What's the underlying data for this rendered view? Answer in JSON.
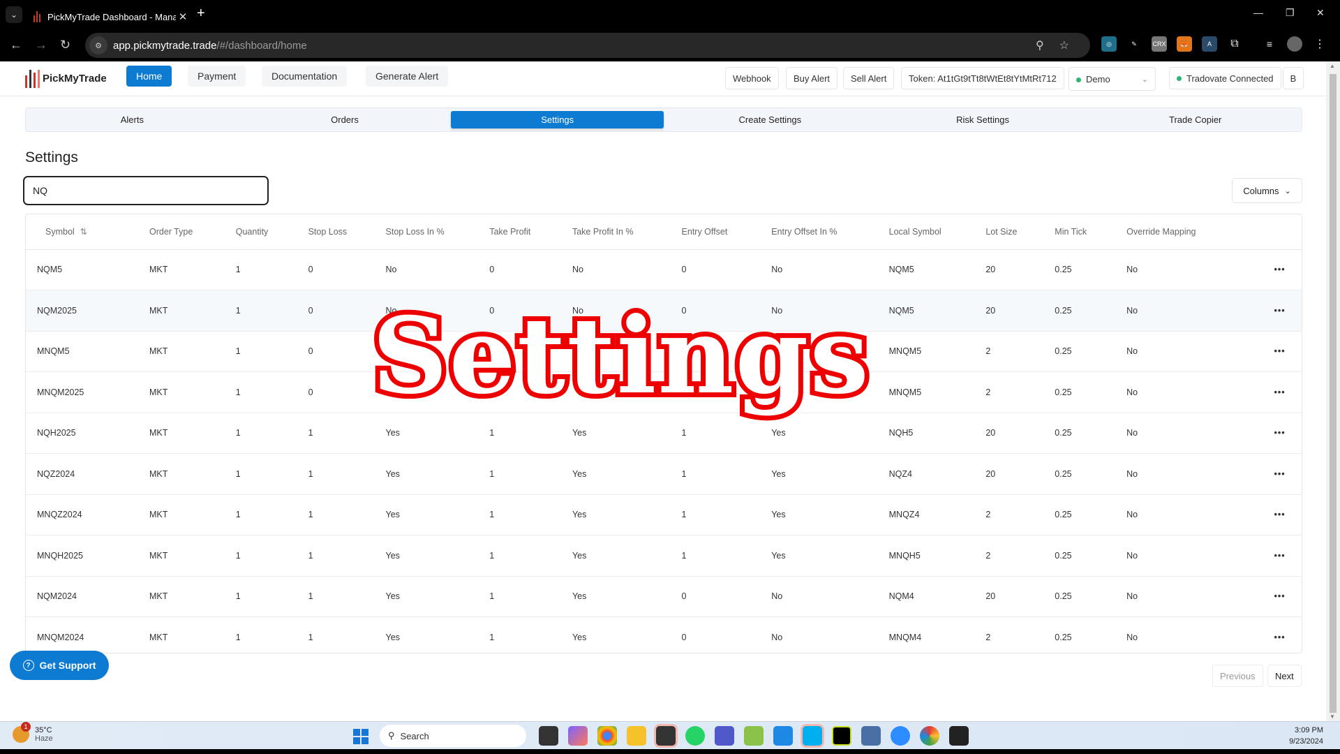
{
  "browser": {
    "tab_title": "PickMyTrade Dashboard - Mana",
    "url_host": "app.pickmytrade.trade",
    "url_path": "/#/dashboard/home",
    "extensions": [
      "web-icon",
      "broom-icon",
      "crx-icon",
      "metamask-icon",
      "tool-icon",
      "puzzle-icon",
      "media-icon",
      "profile-avatar"
    ]
  },
  "header": {
    "brand": "PickMyTrade",
    "nav": [
      {
        "label": "Home",
        "active": true
      },
      {
        "label": "Payment",
        "active": false
      },
      {
        "label": "Documentation",
        "active": false
      },
      {
        "label": "Generate Alert",
        "active": false
      }
    ],
    "webhook": "Webhook",
    "buy_alert": "Buy Alert",
    "sell_alert": "Sell Alert",
    "token": "Token: At1tGt9tTt8tWtEt8tYtMtRt712",
    "account_select": "Demo",
    "connection_status": "Tradovate Connected",
    "user_initial": "B",
    "status_color": "#2bb673"
  },
  "subtabs": [
    {
      "label": "Alerts",
      "active": false
    },
    {
      "label": "Orders",
      "active": false
    },
    {
      "label": "Settings",
      "active": true
    },
    {
      "label": "Create Settings",
      "active": false
    },
    {
      "label": "Risk Settings",
      "active": false
    },
    {
      "label": "Trade Copier",
      "active": false
    }
  ],
  "page": {
    "title": "Settings",
    "search_value": "NQ",
    "columns_button": "Columns",
    "overlay_text": "Settings"
  },
  "table": {
    "headers": [
      "Symbol",
      "Order Type",
      "Quantity",
      "Stop Loss",
      "Stop Loss In %",
      "Take Profit",
      "Take Profit In %",
      "Entry Offset",
      "Entry Offset In %",
      "Local Symbol",
      "Lot Size",
      "Min Tick",
      "Override Mapping"
    ],
    "rows": [
      [
        "NQM5",
        "MKT",
        "1",
        "0",
        "No",
        "0",
        "No",
        "0",
        "No",
        "NQM5",
        "20",
        "0.25",
        "No"
      ],
      [
        "NQM2025",
        "MKT",
        "1",
        "0",
        "No",
        "0",
        "No",
        "0",
        "No",
        "NQM5",
        "20",
        "0.25",
        "No"
      ],
      [
        "MNQM5",
        "MKT",
        "1",
        "0",
        "",
        "",
        "",
        "",
        "",
        "MNQM5",
        "2",
        "0.25",
        "No"
      ],
      [
        "MNQM2025",
        "MKT",
        "1",
        "0",
        "",
        "",
        "",
        "",
        "",
        "MNQM5",
        "2",
        "0.25",
        "No"
      ],
      [
        "NQH2025",
        "MKT",
        "1",
        "1",
        "Yes",
        "1",
        "Yes",
        "1",
        "Yes",
        "NQH5",
        "20",
        "0.25",
        "No"
      ],
      [
        "NQZ2024",
        "MKT",
        "1",
        "1",
        "Yes",
        "1",
        "Yes",
        "1",
        "Yes",
        "NQZ4",
        "20",
        "0.25",
        "No"
      ],
      [
        "MNQZ2024",
        "MKT",
        "1",
        "1",
        "Yes",
        "1",
        "Yes",
        "1",
        "Yes",
        "MNQZ4",
        "2",
        "0.25",
        "No"
      ],
      [
        "MNQH2025",
        "MKT",
        "1",
        "1",
        "Yes",
        "1",
        "Yes",
        "1",
        "Yes",
        "MNQH5",
        "2",
        "0.25",
        "No"
      ],
      [
        "NQM2024",
        "MKT",
        "1",
        "1",
        "Yes",
        "1",
        "Yes",
        "0",
        "No",
        "NQM4",
        "20",
        "0.25",
        "No"
      ],
      [
        "MNQM2024",
        "MKT",
        "1",
        "1",
        "Yes",
        "1",
        "Yes",
        "0",
        "No",
        "MNQM4",
        "2",
        "0.25",
        "No"
      ]
    ],
    "row_menu": "•••"
  },
  "footer": {
    "support": "Get Support",
    "previous": "Previous",
    "next": "Next"
  },
  "taskbar": {
    "temperature": "35°C",
    "condition": "Haze",
    "weather_badge": "1",
    "search_placeholder": "Search",
    "time": "3:09 PM",
    "date": "9/23/2024"
  }
}
